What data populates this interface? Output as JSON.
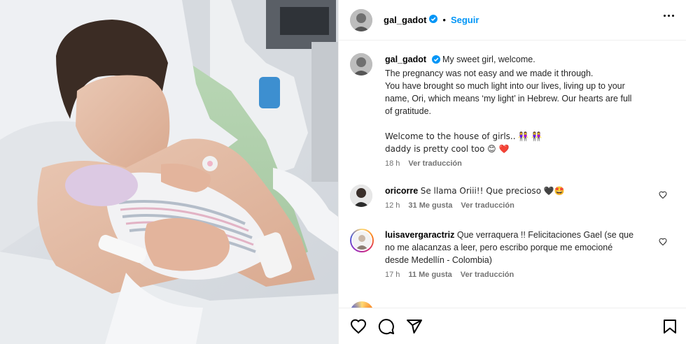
{
  "post": {
    "username": "gal_gadot",
    "follow_label": "Seguir",
    "dot": "•",
    "caption_lines": [
      "My sweet girl, welcome.",
      "The pregnancy was not easy and we made it through.",
      "You have brought so much light into our lives, living up to your",
      "name, Ori, which means ‘my light’ in Hebrew. Our hearts are full",
      "of gratitude."
    ],
    "caption_lines_2": [
      "Welcome to the house of girls.. 👭 👭",
      "daddy is pretty cool too 😊 ❤️"
    ],
    "time": "18 h",
    "translate_label": "Ver traducción"
  },
  "comments": [
    {
      "username": "oricorre",
      "text": "Se llama Oriii!! Que precioso 🖤🤩",
      "time": "12 h",
      "likes": "31 Me gusta",
      "translate_label": "Ver traducción"
    },
    {
      "username": "luisavergaractriz",
      "text_lines": [
        "Que verraquera !! Felicitaciones Gael (se que",
        "no me alacanzas a leer, pero escribo porque me emocioné",
        "desde Medellín - Colombia)"
      ],
      "time": "17 h",
      "likes": "11 Me gusta",
      "translate_label": "Ver traducción"
    }
  ],
  "icons": {
    "like": "heart-icon",
    "comment": "comment-icon",
    "share": "share-icon",
    "save": "bookmark-icon",
    "verified": "verified-badge-icon",
    "more": "more-options-icon"
  },
  "colors": {
    "link_blue": "#0095f6",
    "verified_blue": "#0095f6",
    "muted": "#737373"
  }
}
